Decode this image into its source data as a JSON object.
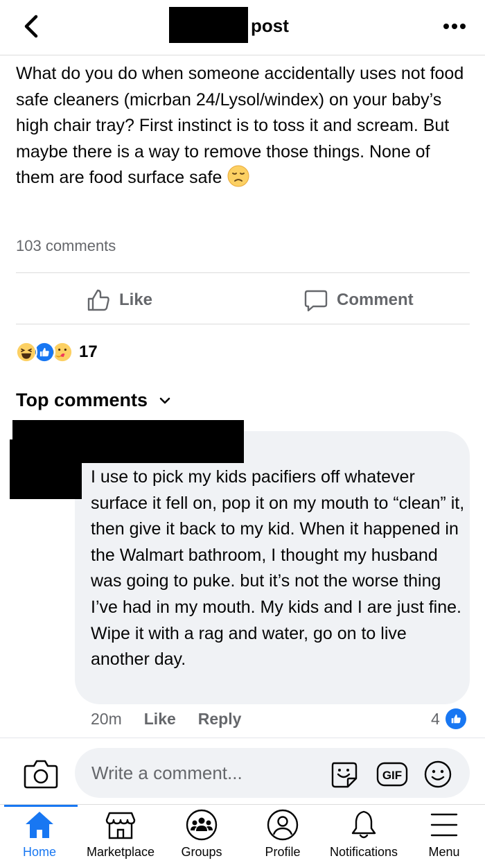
{
  "header": {
    "title": "post"
  },
  "post": {
    "text": "What do you do when someone accidentally uses not food safe cleaners (micrban 24/Lysol/windex) on your baby’s high chair tray? First instinct is to toss it and scream. But maybe there is a way to remove those things. None of them are food surface safe",
    "emoji": "sad-face-emoji",
    "comments_count": "103 comments",
    "like_label": "Like",
    "comment_label": "Comment",
    "reactions": [
      "haha",
      "like",
      "care"
    ],
    "reaction_count": "17"
  },
  "comments_section": {
    "heading": "Top comments",
    "comment": {
      "text": "I use to pick my kids pacifiers off whatever surface it fell on, pop it on my mouth to “clean” it, then give it back to my kid. When it happened in the Walmart bathroom, I thought my husband was going to puke. but it’s not the worse thing I’ve had in my mouth. My kids and I are just fine. Wipe it with a rag and water, go on to live another day.",
      "time": "20m",
      "like_label": "Like",
      "reply_label": "Reply",
      "like_count": "4"
    }
  },
  "composer": {
    "placeholder": "Write a comment...",
    "gif_label": "GIF"
  },
  "tabs": [
    {
      "label": "Home",
      "icon": "home-icon",
      "active": true
    },
    {
      "label": "Marketplace",
      "icon": "marketplace-icon",
      "active": false
    },
    {
      "label": "Groups",
      "icon": "groups-icon",
      "active": false
    },
    {
      "label": "Profile",
      "icon": "profile-icon",
      "active": false
    },
    {
      "label": "Notifications",
      "icon": "bell-icon",
      "active": false
    },
    {
      "label": "Menu",
      "icon": "menu-icon",
      "active": false
    }
  ],
  "colors": {
    "accent": "#1877f2",
    "secondary_text": "#65676b",
    "bubble": "#f0f2f5"
  }
}
